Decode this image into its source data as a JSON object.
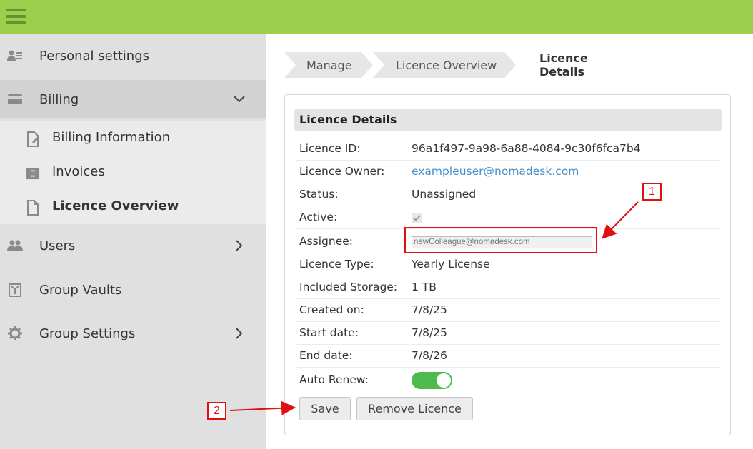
{
  "sidebar": {
    "items": [
      {
        "label": "Personal settings",
        "icon": "person-settings-icon"
      },
      {
        "label": "Billing",
        "icon": "billing-card-icon"
      },
      {
        "label": "Users",
        "icon": "users-icon"
      },
      {
        "label": "Group Vaults",
        "icon": "vault-icon"
      },
      {
        "label": "Group Settings",
        "icon": "gear-icon"
      }
    ],
    "billing_sub": [
      {
        "label": "Billing Information",
        "icon": "document-edit-icon"
      },
      {
        "label": "Invoices",
        "icon": "invoices-icon"
      },
      {
        "label": "Licence Overview",
        "icon": "document-icon"
      }
    ]
  },
  "breadcrumb": {
    "items": [
      "Manage",
      "Licence Overview"
    ],
    "current": "Licence Details"
  },
  "card": {
    "title": "Licence Details",
    "fields": {
      "licence_id": {
        "label": "Licence ID:",
        "value": "96a1f497-9a98-6a88-4084-9c30f6fca7b4"
      },
      "owner": {
        "label": "Licence Owner:",
        "value": "exampleuser@nomadesk.com"
      },
      "status": {
        "label": "Status:",
        "value": "Unassigned"
      },
      "active": {
        "label": "Active:",
        "checked": true
      },
      "assignee": {
        "label": "Assignee:",
        "value": "newColleague@nomadesk.com"
      },
      "type": {
        "label": "Licence Type:",
        "value": "Yearly License"
      },
      "storage": {
        "label": "Included Storage:",
        "value": "1 TB"
      },
      "created": {
        "label": "Created on:",
        "value": "7/8/25"
      },
      "start": {
        "label": "Start date:",
        "value": "7/8/25"
      },
      "end": {
        "label": "End date:",
        "value": "7/8/26"
      },
      "auto_renew": {
        "label": "Auto Renew:",
        "on": true
      }
    },
    "save_label": "Save",
    "remove_label": "Remove Licence"
  },
  "callouts": [
    "1",
    "2"
  ],
  "colors": {
    "topbar": "#9ccf4b",
    "toggle_on": "#4dbb4d",
    "link": "#4a90c8",
    "callout_red": "#e01010"
  }
}
